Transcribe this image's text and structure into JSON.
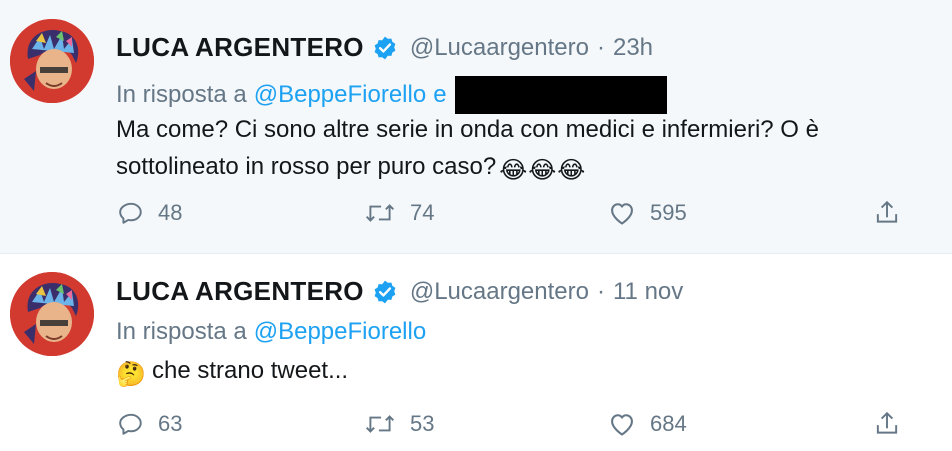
{
  "colors": {
    "accent": "#1da1f2",
    "muted": "#657786",
    "text": "#14171a",
    "highlight_bg": "#f5f8fa"
  },
  "icons": {
    "verified": "verified-badge-icon",
    "reply": "reply-icon",
    "retweet": "retweet-icon",
    "like": "heart-icon",
    "share": "share-icon",
    "avatar": "avatar-image"
  },
  "tweets": [
    {
      "name": "LUCA ARGENTERO",
      "handle": "@Lucaargentero",
      "dot": "·",
      "time": "23h",
      "reply_prefix": "In risposta a",
      "reply_mention": "@BeppeFiorello",
      "reply_and": "e",
      "text_line1": "Ma come? Ci sono altre serie in onda con medici e infermieri? O è",
      "text_line2": "sottolineato in rosso per puro caso?",
      "emojis": [
        "😂",
        "😂",
        "😂"
      ],
      "replies": "48",
      "retweets": "74",
      "likes": "595"
    },
    {
      "name": "LUCA ARGENTERO",
      "handle": "@Lucaargentero",
      "dot": "·",
      "time": "11 nov",
      "reply_prefix": "In risposta a",
      "reply_mention": "@BeppeFiorello",
      "emoji": "🤔",
      "text": "che strano tweet...",
      "replies": "63",
      "retweets": "53",
      "likes": "684"
    }
  ]
}
